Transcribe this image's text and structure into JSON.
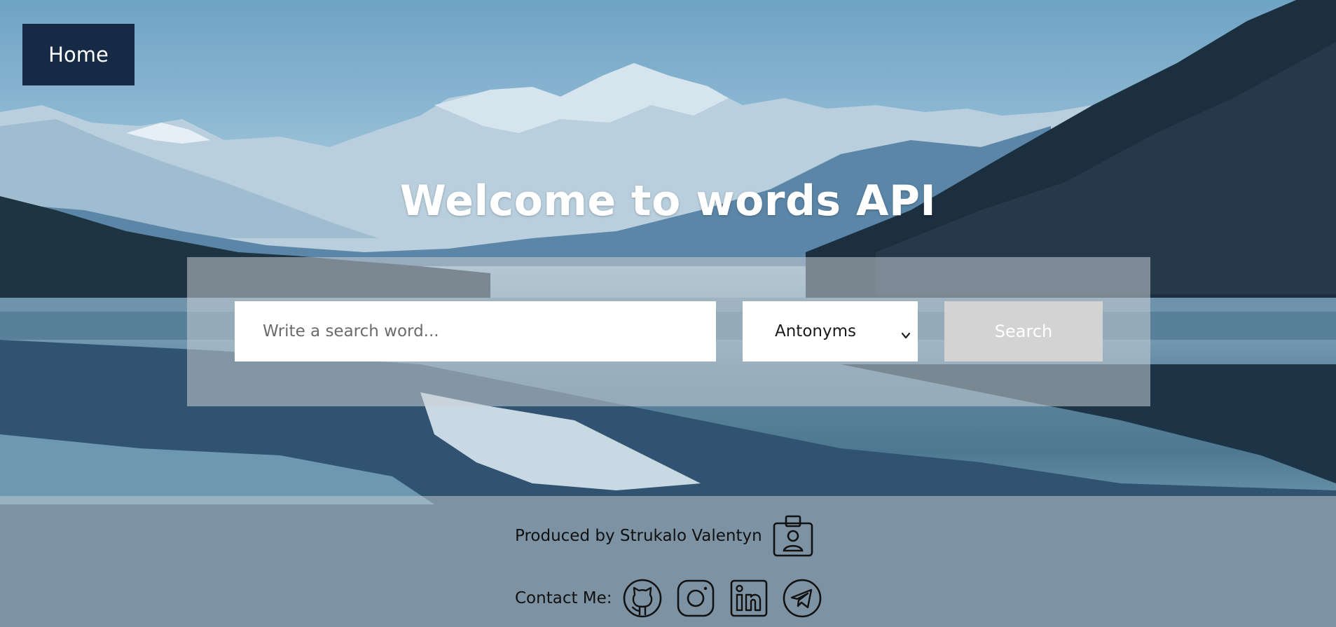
{
  "nav": {
    "home_label": "Home"
  },
  "hero": {
    "title": "Welcome to words API"
  },
  "search": {
    "placeholder": "Write a search word...",
    "value": "",
    "type_selected": "Antonyms",
    "button_label": "Search"
  },
  "footer": {
    "produced_by": "Produced by Strukalo Valentyn",
    "contact_label": "Contact Me:",
    "icons": [
      "id-badge-icon",
      "github-icon",
      "instagram-icon",
      "linkedin-icon",
      "telegram-icon"
    ]
  },
  "colors": {
    "home_bg": "#162a45",
    "search_btn_bg": "#d3d3d3",
    "title": "#ffffff"
  }
}
